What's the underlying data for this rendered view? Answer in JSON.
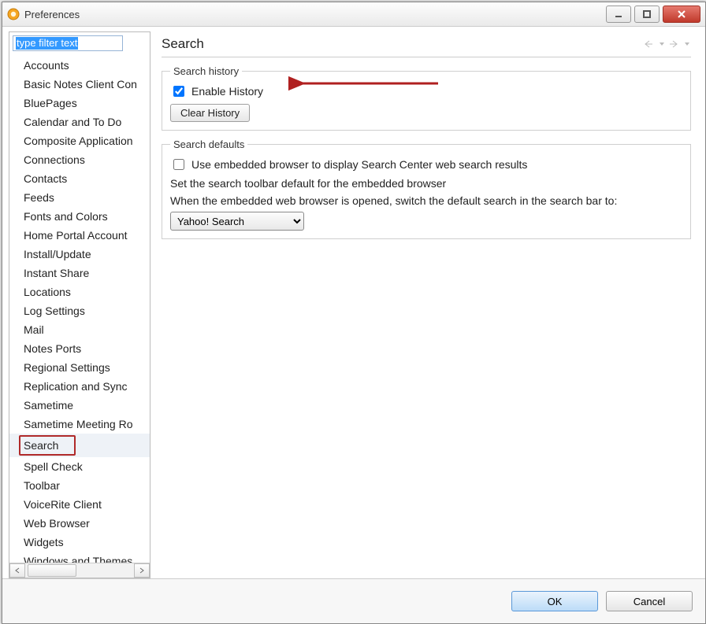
{
  "window": {
    "title": "Preferences"
  },
  "sidebar": {
    "filter_placeholder": "type filter text",
    "items": [
      "Accounts",
      "Basic Notes Client Con",
      "BluePages",
      "Calendar and To Do",
      "Composite Application",
      "Connections",
      "Contacts",
      "Feeds",
      "Fonts and Colors",
      "Home Portal Account",
      "Install/Update",
      "Instant Share",
      "Locations",
      "Log Settings",
      "Mail",
      "Notes Ports",
      "Regional Settings",
      "Replication and Sync",
      "Sametime",
      "Sametime Meeting Ro",
      "Search",
      "Spell Check",
      "Toolbar",
      "VoiceRite Client",
      "Web Browser",
      "Widgets",
      "Windows and Themes"
    ],
    "selected_index": 20
  },
  "page": {
    "title": "Search",
    "history_group": "Search history",
    "enable_history_label": "Enable History",
    "enable_history_checked": true,
    "clear_history_label": "Clear History",
    "defaults_group": "Search defaults",
    "use_embedded_label": "Use embedded browser to display Search Center web search results",
    "use_embedded_checked": false,
    "desc1": "Set the search toolbar default for the embedded browser",
    "desc2": "When the embedded web browser is opened, switch the default search in the search bar to:",
    "dropdown_value": "Yahoo! Search"
  },
  "buttons": {
    "ok": "OK",
    "cancel": "Cancel"
  }
}
